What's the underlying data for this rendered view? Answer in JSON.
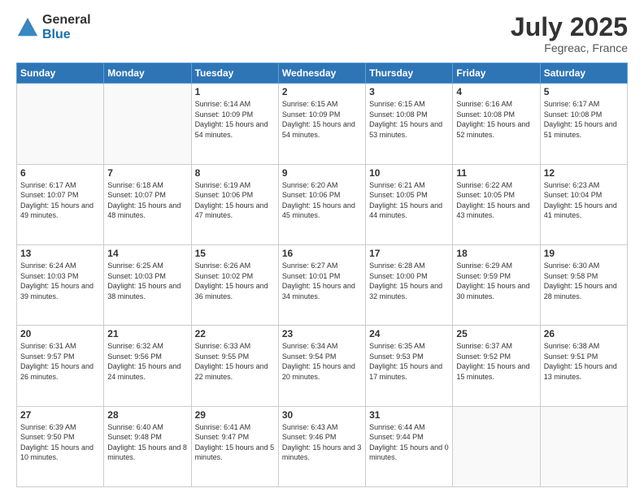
{
  "header": {
    "logo_general": "General",
    "logo_blue": "Blue",
    "month": "July 2025",
    "location": "Fegreac, France"
  },
  "weekdays": [
    "Sunday",
    "Monday",
    "Tuesday",
    "Wednesday",
    "Thursday",
    "Friday",
    "Saturday"
  ],
  "weeks": [
    [
      {
        "day": "",
        "sunrise": "",
        "sunset": "",
        "daylight": ""
      },
      {
        "day": "",
        "sunrise": "",
        "sunset": "",
        "daylight": ""
      },
      {
        "day": "1",
        "sunrise": "Sunrise: 6:14 AM",
        "sunset": "Sunset: 10:09 PM",
        "daylight": "Daylight: 15 hours and 54 minutes."
      },
      {
        "day": "2",
        "sunrise": "Sunrise: 6:15 AM",
        "sunset": "Sunset: 10:09 PM",
        "daylight": "Daylight: 15 hours and 54 minutes."
      },
      {
        "day": "3",
        "sunrise": "Sunrise: 6:15 AM",
        "sunset": "Sunset: 10:08 PM",
        "daylight": "Daylight: 15 hours and 53 minutes."
      },
      {
        "day": "4",
        "sunrise": "Sunrise: 6:16 AM",
        "sunset": "Sunset: 10:08 PM",
        "daylight": "Daylight: 15 hours and 52 minutes."
      },
      {
        "day": "5",
        "sunrise": "Sunrise: 6:17 AM",
        "sunset": "Sunset: 10:08 PM",
        "daylight": "Daylight: 15 hours and 51 minutes."
      }
    ],
    [
      {
        "day": "6",
        "sunrise": "Sunrise: 6:17 AM",
        "sunset": "Sunset: 10:07 PM",
        "daylight": "Daylight: 15 hours and 49 minutes."
      },
      {
        "day": "7",
        "sunrise": "Sunrise: 6:18 AM",
        "sunset": "Sunset: 10:07 PM",
        "daylight": "Daylight: 15 hours and 48 minutes."
      },
      {
        "day": "8",
        "sunrise": "Sunrise: 6:19 AM",
        "sunset": "Sunset: 10:06 PM",
        "daylight": "Daylight: 15 hours and 47 minutes."
      },
      {
        "day": "9",
        "sunrise": "Sunrise: 6:20 AM",
        "sunset": "Sunset: 10:06 PM",
        "daylight": "Daylight: 15 hours and 45 minutes."
      },
      {
        "day": "10",
        "sunrise": "Sunrise: 6:21 AM",
        "sunset": "Sunset: 10:05 PM",
        "daylight": "Daylight: 15 hours and 44 minutes."
      },
      {
        "day": "11",
        "sunrise": "Sunrise: 6:22 AM",
        "sunset": "Sunset: 10:05 PM",
        "daylight": "Daylight: 15 hours and 43 minutes."
      },
      {
        "day": "12",
        "sunrise": "Sunrise: 6:23 AM",
        "sunset": "Sunset: 10:04 PM",
        "daylight": "Daylight: 15 hours and 41 minutes."
      }
    ],
    [
      {
        "day": "13",
        "sunrise": "Sunrise: 6:24 AM",
        "sunset": "Sunset: 10:03 PM",
        "daylight": "Daylight: 15 hours and 39 minutes."
      },
      {
        "day": "14",
        "sunrise": "Sunrise: 6:25 AM",
        "sunset": "Sunset: 10:03 PM",
        "daylight": "Daylight: 15 hours and 38 minutes."
      },
      {
        "day": "15",
        "sunrise": "Sunrise: 6:26 AM",
        "sunset": "Sunset: 10:02 PM",
        "daylight": "Daylight: 15 hours and 36 minutes."
      },
      {
        "day": "16",
        "sunrise": "Sunrise: 6:27 AM",
        "sunset": "Sunset: 10:01 PM",
        "daylight": "Daylight: 15 hours and 34 minutes."
      },
      {
        "day": "17",
        "sunrise": "Sunrise: 6:28 AM",
        "sunset": "Sunset: 10:00 PM",
        "daylight": "Daylight: 15 hours and 32 minutes."
      },
      {
        "day": "18",
        "sunrise": "Sunrise: 6:29 AM",
        "sunset": "Sunset: 9:59 PM",
        "daylight": "Daylight: 15 hours and 30 minutes."
      },
      {
        "day": "19",
        "sunrise": "Sunrise: 6:30 AM",
        "sunset": "Sunset: 9:58 PM",
        "daylight": "Daylight: 15 hours and 28 minutes."
      }
    ],
    [
      {
        "day": "20",
        "sunrise": "Sunrise: 6:31 AM",
        "sunset": "Sunset: 9:57 PM",
        "daylight": "Daylight: 15 hours and 26 minutes."
      },
      {
        "day": "21",
        "sunrise": "Sunrise: 6:32 AM",
        "sunset": "Sunset: 9:56 PM",
        "daylight": "Daylight: 15 hours and 24 minutes."
      },
      {
        "day": "22",
        "sunrise": "Sunrise: 6:33 AM",
        "sunset": "Sunset: 9:55 PM",
        "daylight": "Daylight: 15 hours and 22 minutes."
      },
      {
        "day": "23",
        "sunrise": "Sunrise: 6:34 AM",
        "sunset": "Sunset: 9:54 PM",
        "daylight": "Daylight: 15 hours and 20 minutes."
      },
      {
        "day": "24",
        "sunrise": "Sunrise: 6:35 AM",
        "sunset": "Sunset: 9:53 PM",
        "daylight": "Daylight: 15 hours and 17 minutes."
      },
      {
        "day": "25",
        "sunrise": "Sunrise: 6:37 AM",
        "sunset": "Sunset: 9:52 PM",
        "daylight": "Daylight: 15 hours and 15 minutes."
      },
      {
        "day": "26",
        "sunrise": "Sunrise: 6:38 AM",
        "sunset": "Sunset: 9:51 PM",
        "daylight": "Daylight: 15 hours and 13 minutes."
      }
    ],
    [
      {
        "day": "27",
        "sunrise": "Sunrise: 6:39 AM",
        "sunset": "Sunset: 9:50 PM",
        "daylight": "Daylight: 15 hours and 10 minutes."
      },
      {
        "day": "28",
        "sunrise": "Sunrise: 6:40 AM",
        "sunset": "Sunset: 9:48 PM",
        "daylight": "Daylight: 15 hours and 8 minutes."
      },
      {
        "day": "29",
        "sunrise": "Sunrise: 6:41 AM",
        "sunset": "Sunset: 9:47 PM",
        "daylight": "Daylight: 15 hours and 5 minutes."
      },
      {
        "day": "30",
        "sunrise": "Sunrise: 6:43 AM",
        "sunset": "Sunset: 9:46 PM",
        "daylight": "Daylight: 15 hours and 3 minutes."
      },
      {
        "day": "31",
        "sunrise": "Sunrise: 6:44 AM",
        "sunset": "Sunset: 9:44 PM",
        "daylight": "Daylight: 15 hours and 0 minutes."
      },
      {
        "day": "",
        "sunrise": "",
        "sunset": "",
        "daylight": ""
      },
      {
        "day": "",
        "sunrise": "",
        "sunset": "",
        "daylight": ""
      }
    ]
  ]
}
